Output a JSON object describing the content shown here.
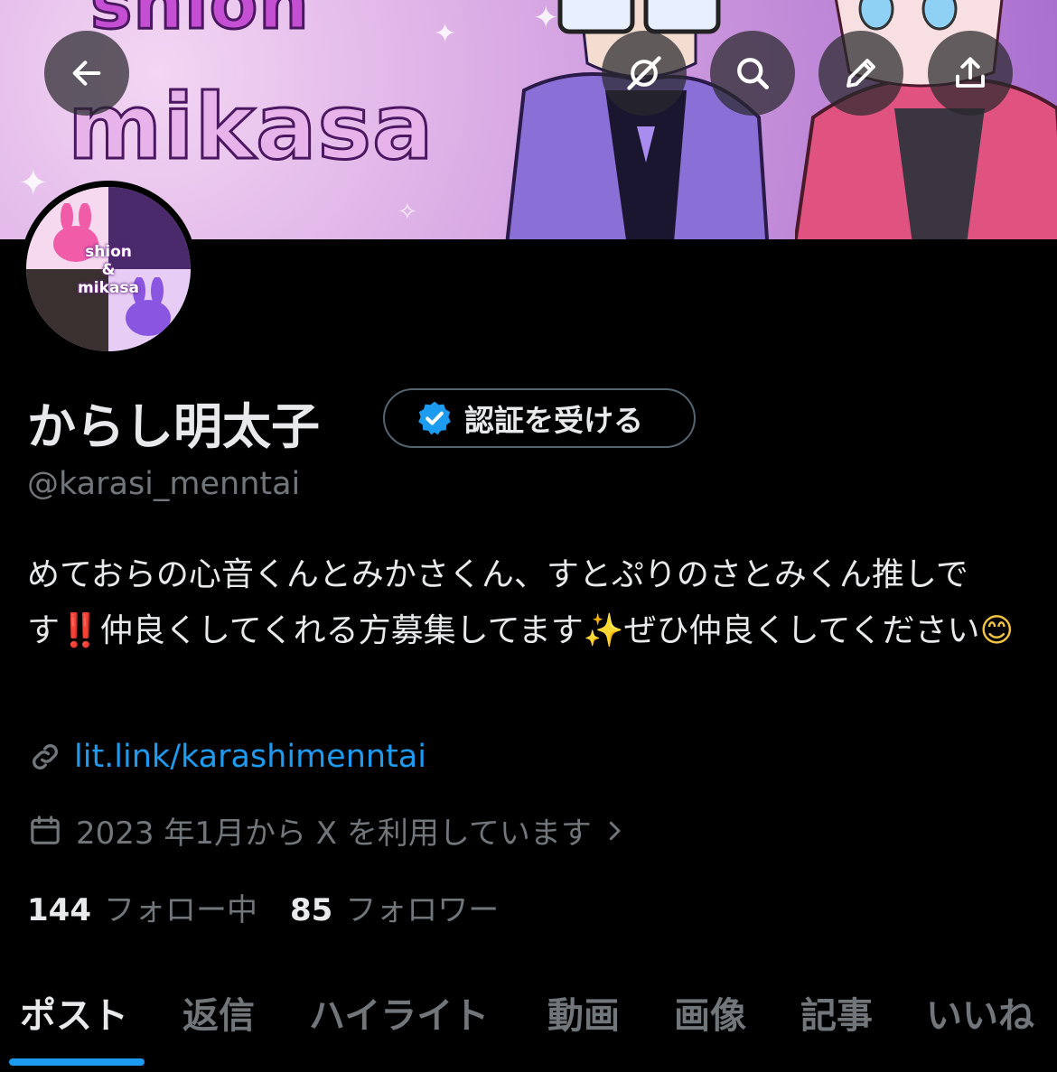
{
  "banner": {
    "text_line1": "shion",
    "text_line2": "mikasa"
  },
  "toolbar": {
    "back_icon": "arrow-left-icon",
    "grok_icon": "grok-icon",
    "search_icon": "search-icon",
    "edit_icon": "pencil-icon",
    "share_icon": "share-icon"
  },
  "avatar": {
    "text_top": "shion",
    "text_mid": "&",
    "text_bottom": "mikasa"
  },
  "profile": {
    "display_name": "からし明太子",
    "verify_button_label": "認証を受ける",
    "handle": "@karasi_menntai",
    "bio_part1": "めておらの心音くんとみかさくん、すとぷりのさとみくん推しです",
    "bio_bang": "‼️",
    "bio_part2": "仲良くしてくれる方募集してます",
    "bio_sparkle": "✨",
    "bio_part3": "ぜひ仲良くしてください",
    "bio_smile": "😊",
    "link": "lit.link/karashimenntai",
    "joined": "2023 年1月から X を利用しています",
    "following_count": "144",
    "following_label": "フォロー中",
    "followers_count": "85",
    "followers_label": "フォロワー"
  },
  "tabs": [
    "ポスト",
    "返信",
    "ハイライト",
    "動画",
    "画像",
    "記事",
    "いいね"
  ],
  "colors": {
    "accent": "#1d9bf0",
    "background": "#000000",
    "muted_text": "#71767b",
    "primary_text": "#e7e9ea"
  }
}
